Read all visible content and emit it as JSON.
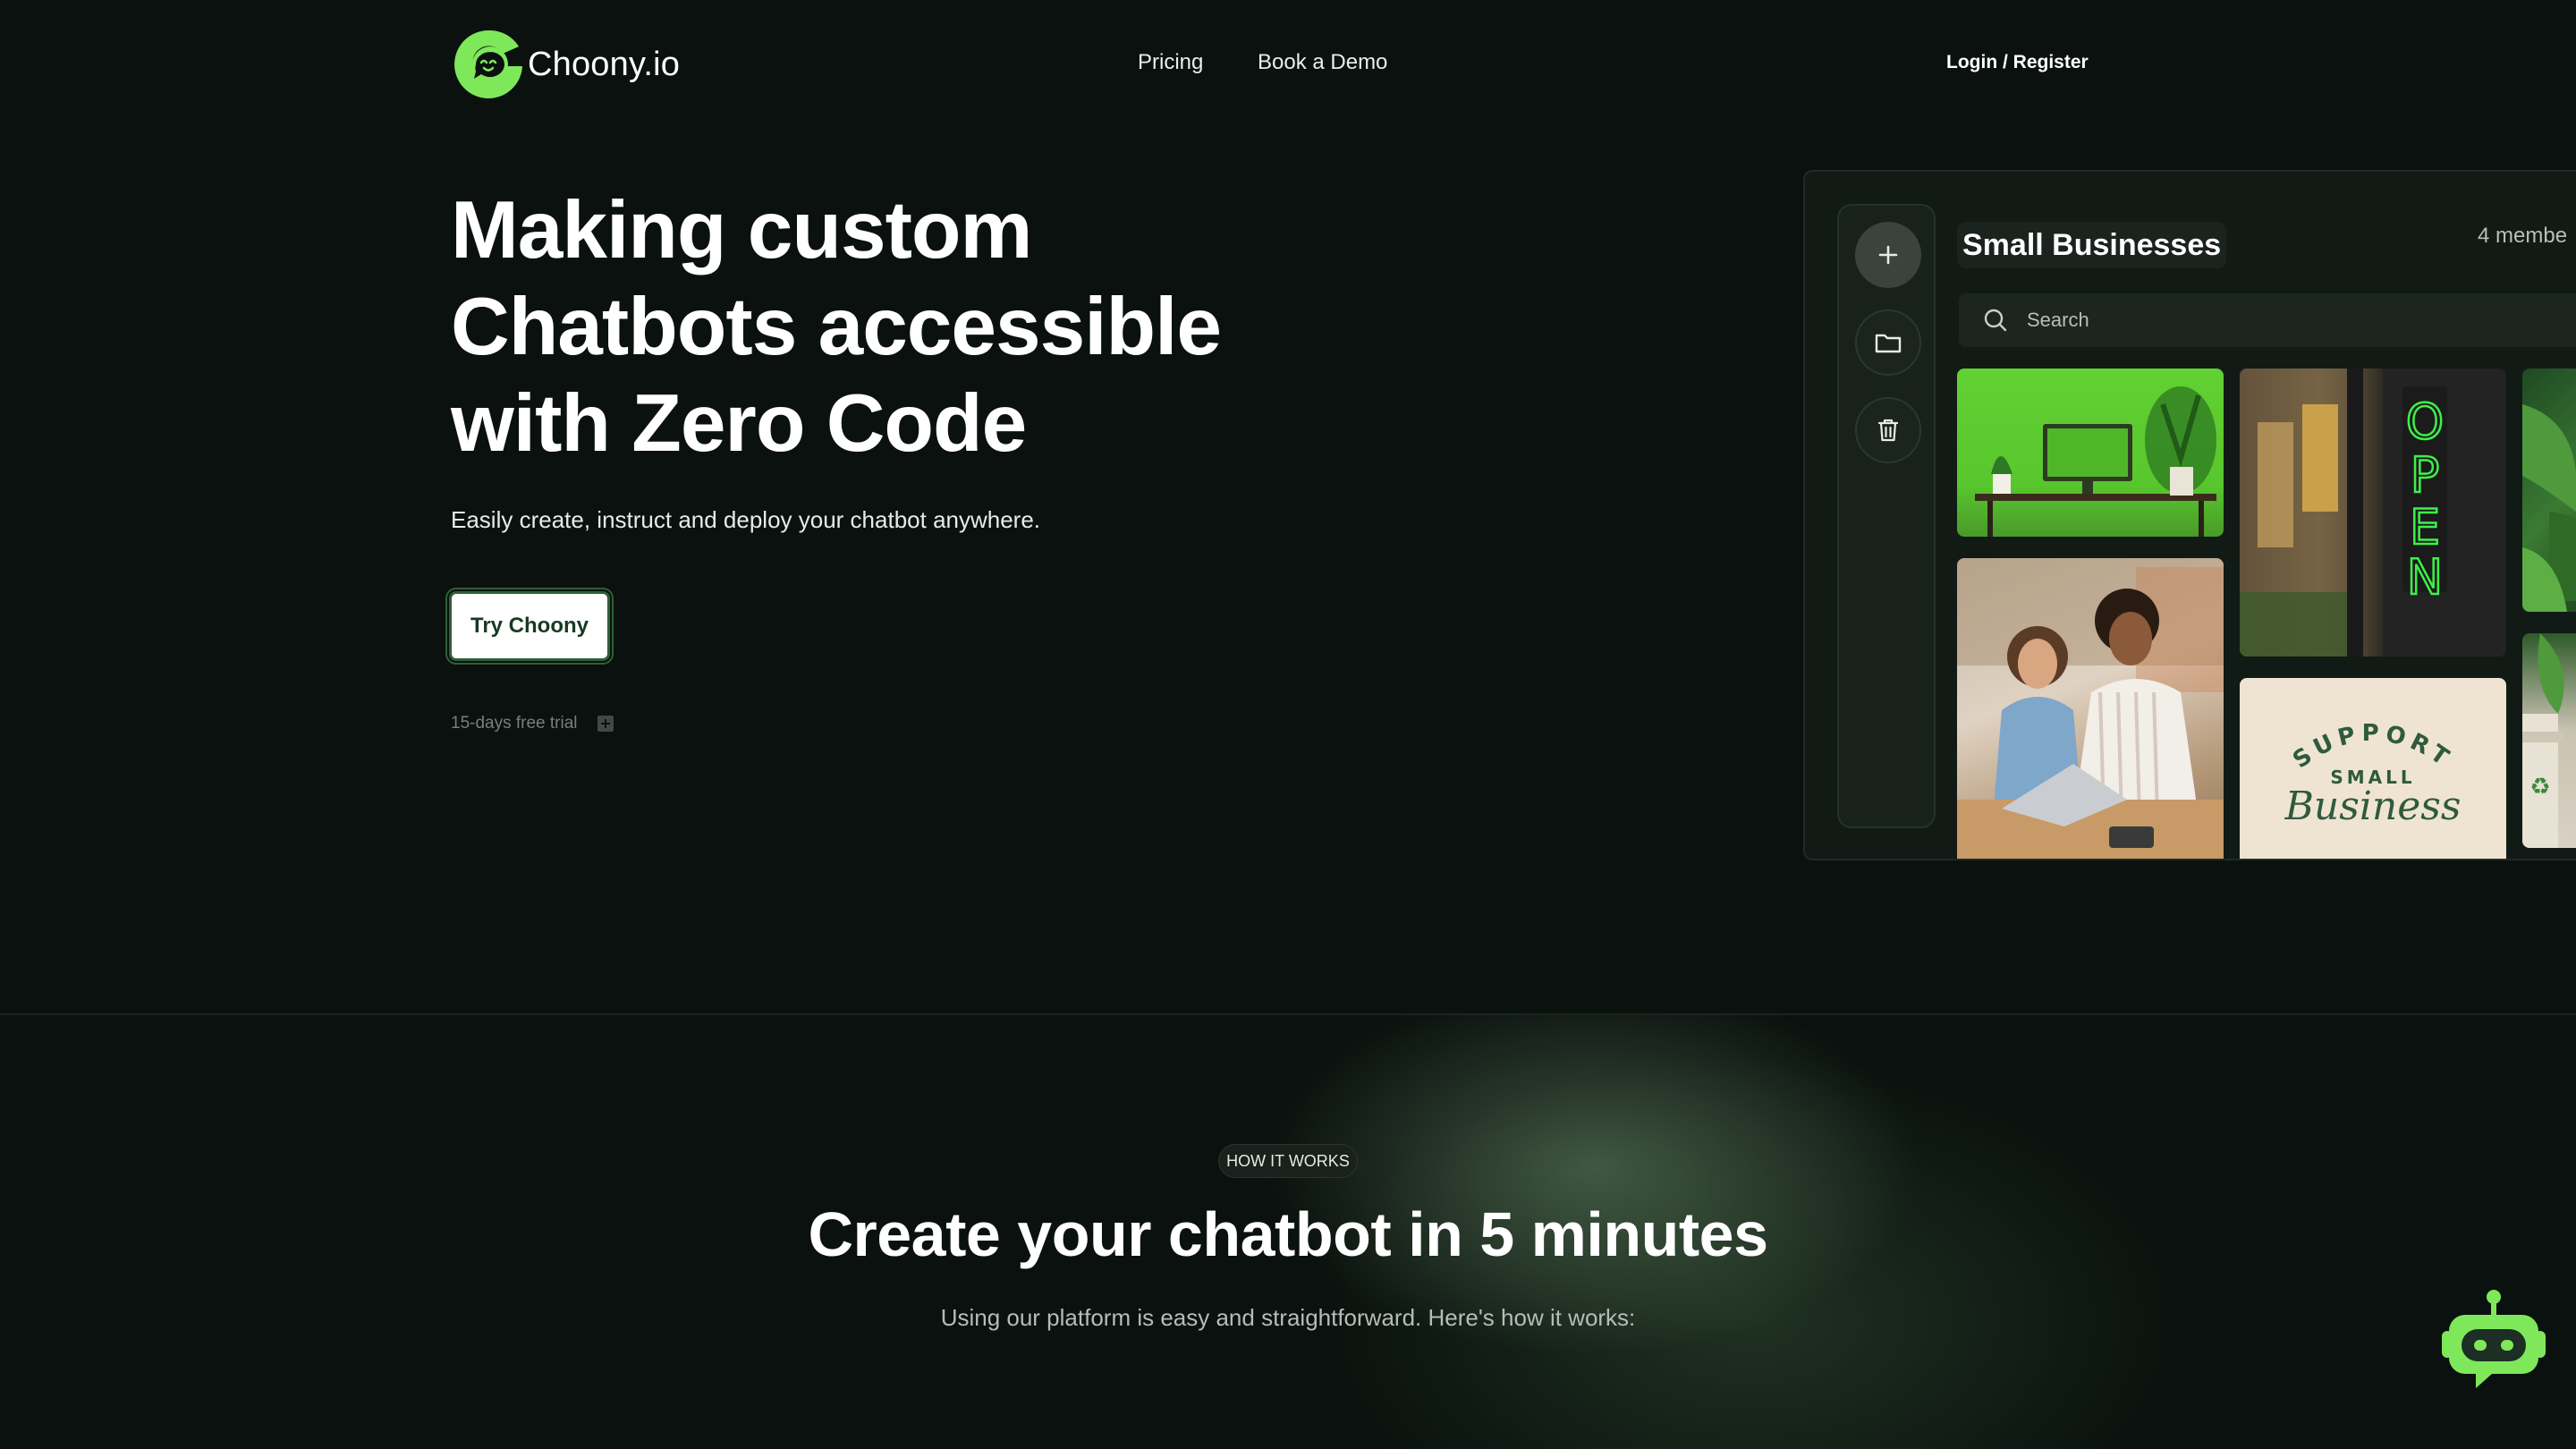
{
  "brand": {
    "name": "Choony.io",
    "accent": "#7ee85a"
  },
  "nav": {
    "links": [
      "Pricing",
      "Book a Demo"
    ],
    "login": "Login / Register"
  },
  "hero": {
    "title_lines": [
      "Making custom",
      "Chatbots accessible",
      "with Zero Code"
    ],
    "subtitle": "Easily create, instruct and deploy your chatbot anywhere.",
    "cta": "Try Choony",
    "trial_note": "15-days free trial"
  },
  "app_preview": {
    "group_title": "Small Businesses",
    "members": "4 membe",
    "search_placeholder": "Search",
    "rail_icons": [
      "plus-icon",
      "folder-icon",
      "trash-icon"
    ],
    "images": [
      {
        "name": "green-desk-image"
      },
      {
        "name": "open-sign-image",
        "text": "OPEN"
      },
      {
        "name": "plant-image"
      },
      {
        "name": "shop-owners-image"
      },
      {
        "name": "support-small-business-image",
        "lines": [
          "SUPPORT",
          "SMALL",
          "Business"
        ]
      },
      {
        "name": "coffee-cup-image"
      }
    ]
  },
  "how_it_works": {
    "badge": "HOW IT WORKS",
    "title": "Create your chatbot in 5 minutes",
    "subtitle": "Using our platform is easy and straightforward. Here's how it works:"
  },
  "chat_widget": {
    "icon": "robot-icon"
  }
}
